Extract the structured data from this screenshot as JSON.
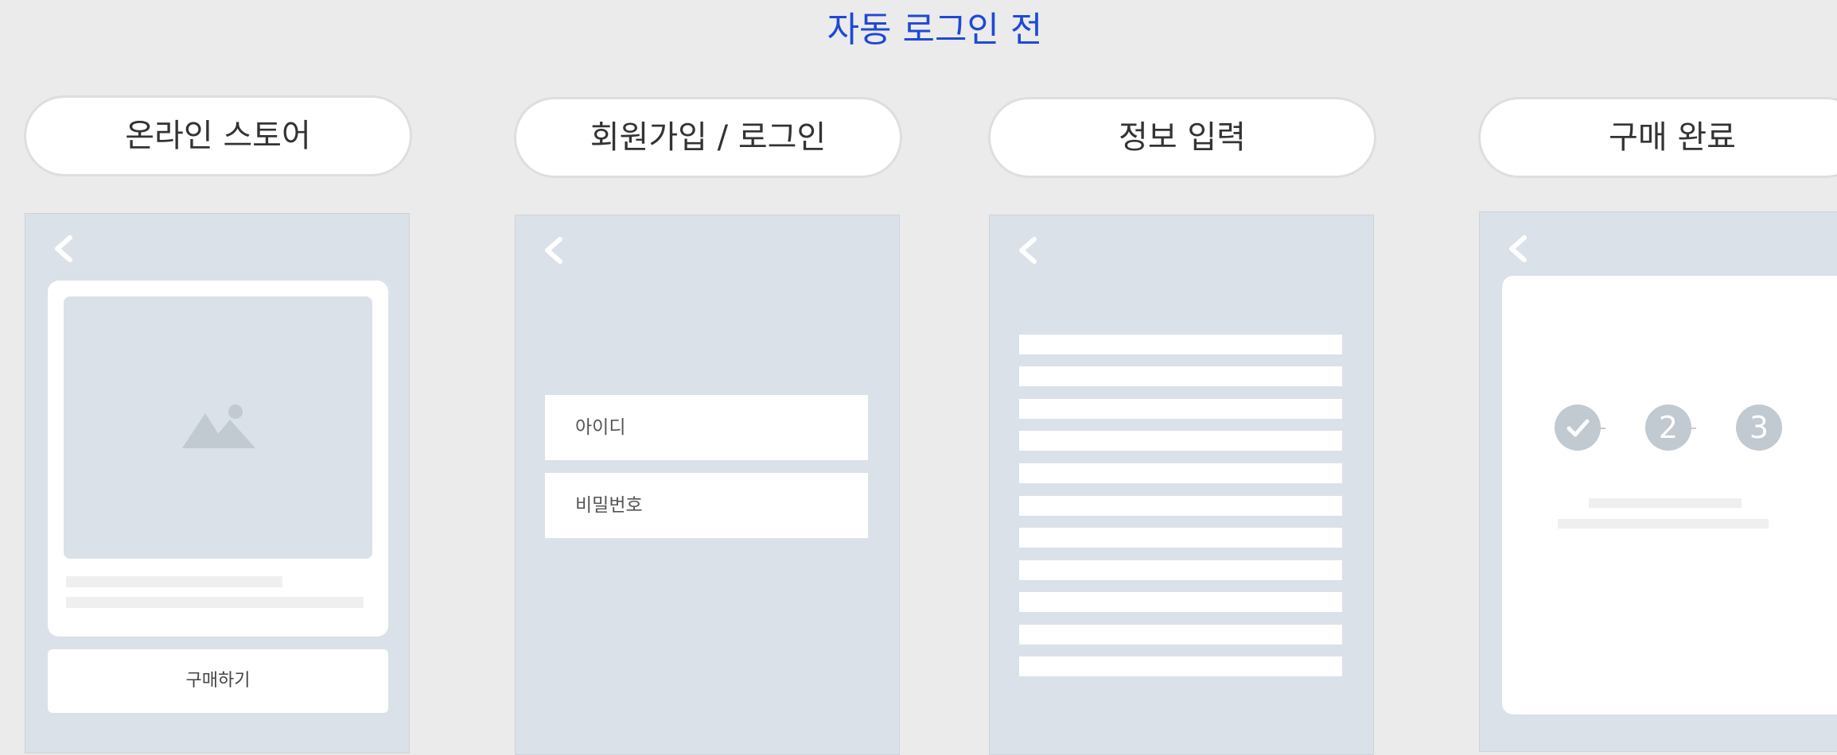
{
  "page_title": "자동 로그인 전",
  "steps": [
    {
      "label": "온라인 스토어"
    },
    {
      "label": "회원가입 / 로그인"
    },
    {
      "label": "정보 입력"
    },
    {
      "label": "구매 완료"
    }
  ],
  "store": {
    "buy_button_label": "구매하기",
    "image_icon": "mountain-image-icon"
  },
  "login": {
    "id_field": "아이디",
    "password_field": "비밀번호"
  },
  "complete": {
    "step_labels": [
      "2",
      "3"
    ],
    "check_icon": "check-icon"
  },
  "icons": {
    "back": "chevron-left-icon"
  },
  "colors": {
    "background": "#ebebeb",
    "title": "#1f49d6",
    "phone_screen": "#dbe1e8",
    "placeholder_gray": "#c1c9d1"
  }
}
